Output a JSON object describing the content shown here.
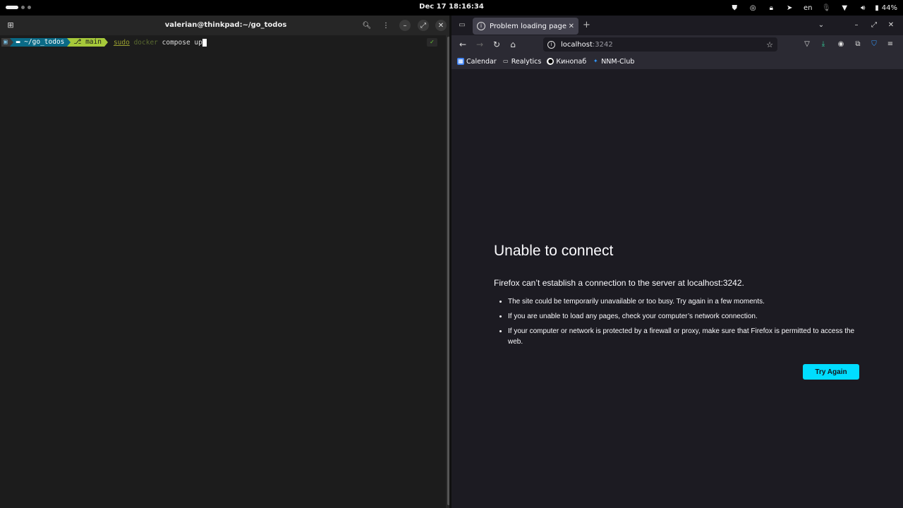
{
  "topbar": {
    "clock": "Dec 17  18:16:34",
    "lang": "en",
    "battery": "44%"
  },
  "terminal": {
    "title": "valerian@thinkpad:~/go_todos",
    "prompt": {
      "dir": "~/go_todos",
      "branch": "main"
    },
    "command": {
      "sudo": "sudo",
      "docker": "docker",
      "rest": " compose up"
    },
    "status": "✓"
  },
  "firefox": {
    "tab": {
      "title": "Problem loading page"
    },
    "url": {
      "host": "localhost",
      "port": ":3242"
    },
    "bookmarks": [
      {
        "label": "Calendar"
      },
      {
        "label": "Realytics"
      },
      {
        "label": "Кинопаб"
      },
      {
        "label": "NNM-Club"
      }
    ],
    "error": {
      "title": "Unable to connect",
      "description": "Firefox can’t establish a connection to the server at localhost:3242.",
      "tips": [
        "The site could be temporarily unavailable or too busy. Try again in a few moments.",
        "If you are unable to load any pages, check your computer’s network connection.",
        "If your computer or network is protected by a firewall or proxy, make sure that Firefox is permitted to access the web."
      ],
      "button": "Try Again"
    }
  }
}
